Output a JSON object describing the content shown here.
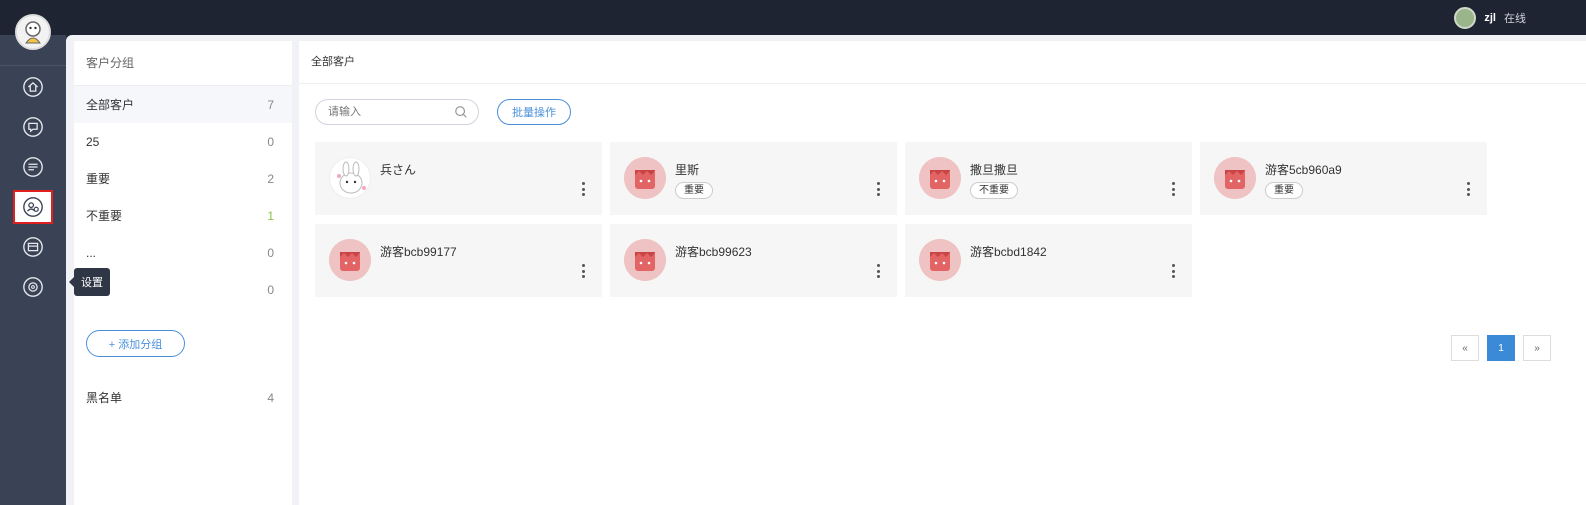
{
  "header": {
    "user_name": "zjl",
    "user_status": "在线"
  },
  "sidebar": {
    "items": [
      {
        "icon": "home-icon"
      },
      {
        "icon": "chat-icon"
      },
      {
        "icon": "message-icon"
      },
      {
        "icon": "customer-icon",
        "active": true
      },
      {
        "icon": "store-icon"
      },
      {
        "icon": "settings-icon"
      }
    ],
    "tooltip": "设置"
  },
  "groups": {
    "title": "客户分组",
    "items": [
      {
        "label": "全部客户",
        "count": "7"
      },
      {
        "label": "25",
        "count": "0"
      },
      {
        "label": "重要",
        "count": "2"
      },
      {
        "label": "不重要",
        "count": "1"
      },
      {
        "label": "...",
        "count": "0"
      },
      {
        "label": "",
        "count": "0"
      }
    ],
    "add_label": "+ 添加分组",
    "blacklist": {
      "label": "黑名单",
      "count": "4"
    }
  },
  "content": {
    "title": "全部客户",
    "search_placeholder": "请输入",
    "batch_label": "批量操作",
    "cards": [
      {
        "name": "兵さん",
        "tag": ""
      },
      {
        "name": "里斯",
        "tag": "重要"
      },
      {
        "name": "撒旦撒旦",
        "tag": "不重要"
      },
      {
        "name": "游客5cb960a9",
        "tag": "重要"
      },
      {
        "name": "游客bcb99177",
        "tag": ""
      },
      {
        "name": "游客bcb99623",
        "tag": ""
      },
      {
        "name": "游客bcbd1842",
        "tag": ""
      }
    ],
    "pager": {
      "prev": "«",
      "current": "1",
      "next": "»"
    }
  },
  "colors": {
    "accent": "#3b8ad8",
    "sidebar_bg": "#3a4255",
    "topbar_bg": "#1f2433",
    "active_outline": "#e02020"
  }
}
